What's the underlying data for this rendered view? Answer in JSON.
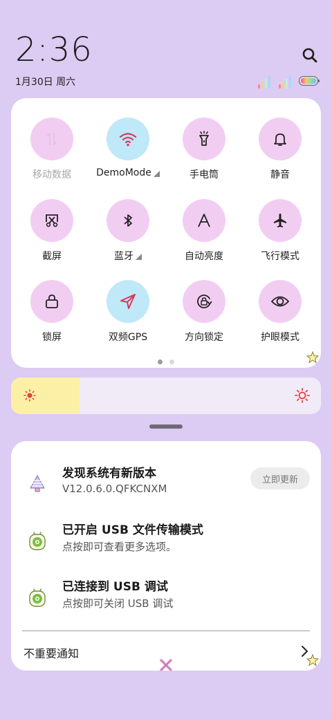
{
  "header": {
    "time": "2:36",
    "date": "1月30日 周六"
  },
  "quick_settings": [
    {
      "label": "移动数据",
      "icon": "mobile-data-icon",
      "active": false,
      "disabled": true,
      "expandable": false
    },
    {
      "label": "DemoMode",
      "icon": "wifi-icon",
      "active": true,
      "disabled": false,
      "expandable": true
    },
    {
      "label": "手电筒",
      "icon": "flashlight-icon",
      "active": false,
      "disabled": false,
      "expandable": false
    },
    {
      "label": "静音",
      "icon": "bell-icon",
      "active": false,
      "disabled": false,
      "expandable": false
    },
    {
      "label": "截屏",
      "icon": "screenshot-icon",
      "active": false,
      "disabled": false,
      "expandable": false
    },
    {
      "label": "蓝牙",
      "icon": "bluetooth-icon",
      "active": false,
      "disabled": false,
      "expandable": true
    },
    {
      "label": "自动亮度",
      "icon": "auto-brightness-icon",
      "active": false,
      "disabled": false,
      "expandable": false
    },
    {
      "label": "飞行模式",
      "icon": "airplane-icon",
      "active": false,
      "disabled": false,
      "expandable": false
    },
    {
      "label": "锁屏",
      "icon": "lock-icon",
      "active": false,
      "disabled": false,
      "expandable": false
    },
    {
      "label": "双频GPS",
      "icon": "gps-icon",
      "active": true,
      "disabled": false,
      "expandable": false
    },
    {
      "label": "方向锁定",
      "icon": "rotation-lock-icon",
      "active": false,
      "disabled": false,
      "expandable": false
    },
    {
      "label": "护眼模式",
      "icon": "eye-icon",
      "active": false,
      "disabled": false,
      "expandable": false
    }
  ],
  "pager": {
    "pages": 2,
    "current": 1
  },
  "brightness": {
    "level": 0.22
  },
  "notifications": {
    "items": [
      {
        "title": "发现系统有新版本",
        "subtitle": "V12.0.6.0.QFKCNXM",
        "icon": "system-update-icon",
        "action": "立即更新"
      },
      {
        "title": "已开启 USB 文件传输模式",
        "subtitle": "点按即可查看更多选项。",
        "icon": "android-settings-icon"
      },
      {
        "title": "已连接到 USB 调试",
        "subtitle": "点按即可关闭 USB 调试",
        "icon": "android-settings-icon"
      }
    ],
    "unimportant_label": "不重要通知"
  },
  "colors": {
    "background": "#dccbf2",
    "tile_inactive": "#f2cdf2",
    "tile_active": "#bfe8f9",
    "brightness_fill": "#fbf0a6",
    "icon_active": "#d63a5a"
  }
}
